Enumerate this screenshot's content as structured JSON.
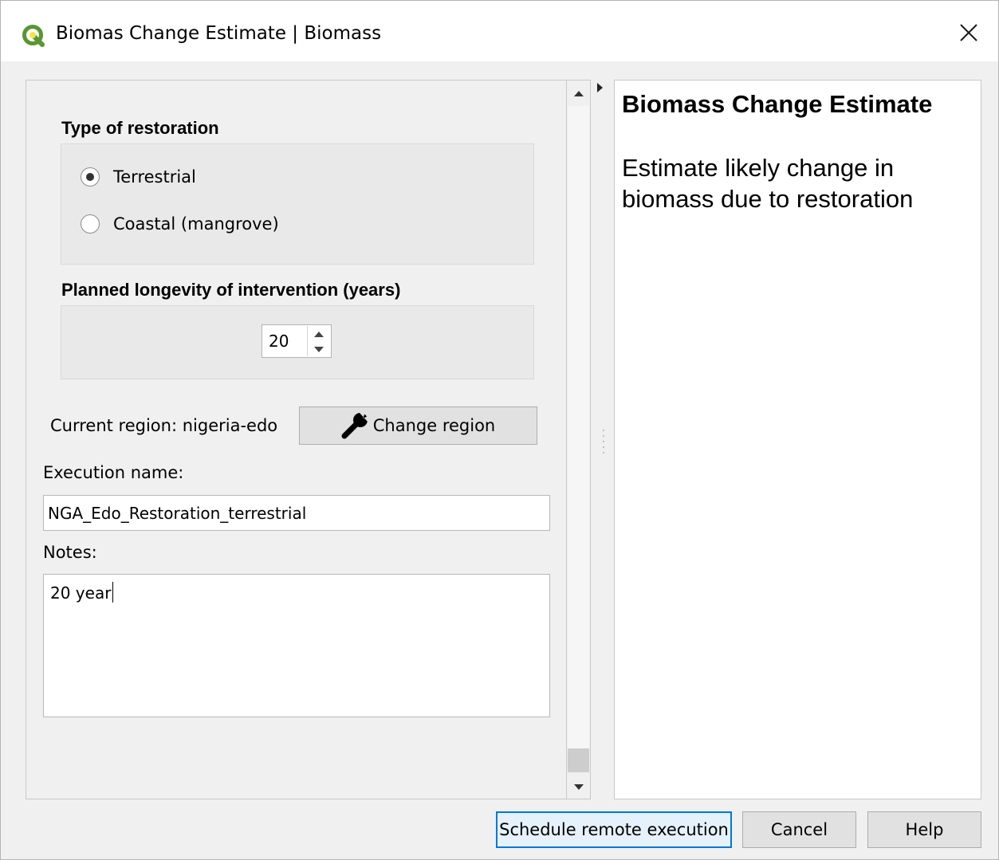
{
  "window": {
    "title": "Biomas Change Estimate | Biomass",
    "icon": "qgis-logo-icon",
    "close_icon": "close-icon"
  },
  "form": {
    "restoration": {
      "title": "Type of restoration",
      "options": [
        {
          "label": "Terrestrial",
          "selected": true
        },
        {
          "label": "Coastal (mangrove)",
          "selected": false
        }
      ]
    },
    "longevity": {
      "title": "Planned longevity of intervention (years)",
      "value": "20"
    },
    "region": {
      "label": "Current region: nigeria-edo",
      "button_label": "Change region",
      "button_icon": "wrench-icon"
    },
    "execution_name": {
      "label": "Execution name:",
      "value": "NGA_Edo_Restoration_terrestrial"
    },
    "notes": {
      "label": "Notes:",
      "value": "20 year"
    }
  },
  "help": {
    "title": "Biomass Change Estimate",
    "description": "Estimate likely change in biomass due to restoration"
  },
  "buttons": {
    "schedule": "Schedule remote execution",
    "cancel": "Cancel",
    "help": "Help"
  },
  "colors": {
    "accent_border": "#0078d7",
    "qgis_green": "#589632",
    "qgis_yellow": "#ee7913"
  }
}
